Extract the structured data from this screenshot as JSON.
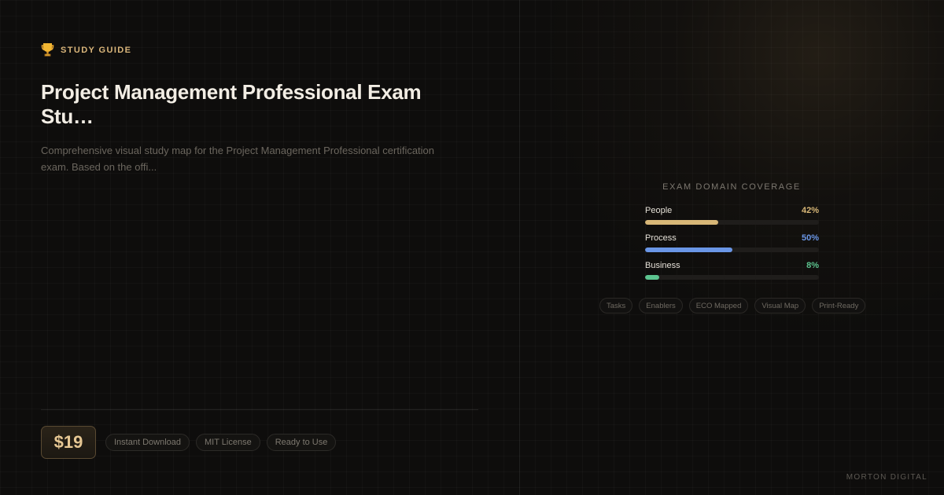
{
  "header": {
    "icon": "trophy-icon",
    "eyebrow": "STUDY GUIDE",
    "title": "Project Management Professional Exam Stu…",
    "description": "Comprehensive visual study map for the Project Management Professional certification exam. Based on the offi..."
  },
  "footer": {
    "price": "$19",
    "pills": [
      "Instant Download",
      "MIT License",
      "Ready to Use"
    ]
  },
  "coverage": {
    "heading": "EXAM DOMAIN COVERAGE",
    "domains": [
      {
        "name": "People",
        "percent_label": "42%",
        "value": 42,
        "color": "#d8b777"
      },
      {
        "name": "Process",
        "percent_label": "50%",
        "value": 50,
        "color": "#6a96e6"
      },
      {
        "name": "Business",
        "percent_label": "8%",
        "value": 8,
        "color": "#5cc48f"
      }
    ],
    "tags": [
      "Tasks",
      "Enablers",
      "ECO Mapped",
      "Visual Map",
      "Print-Ready"
    ]
  },
  "brand": "MORTON DIGITAL",
  "colors": {
    "accent": "#d9b57a",
    "background": "#0e0d0c"
  }
}
